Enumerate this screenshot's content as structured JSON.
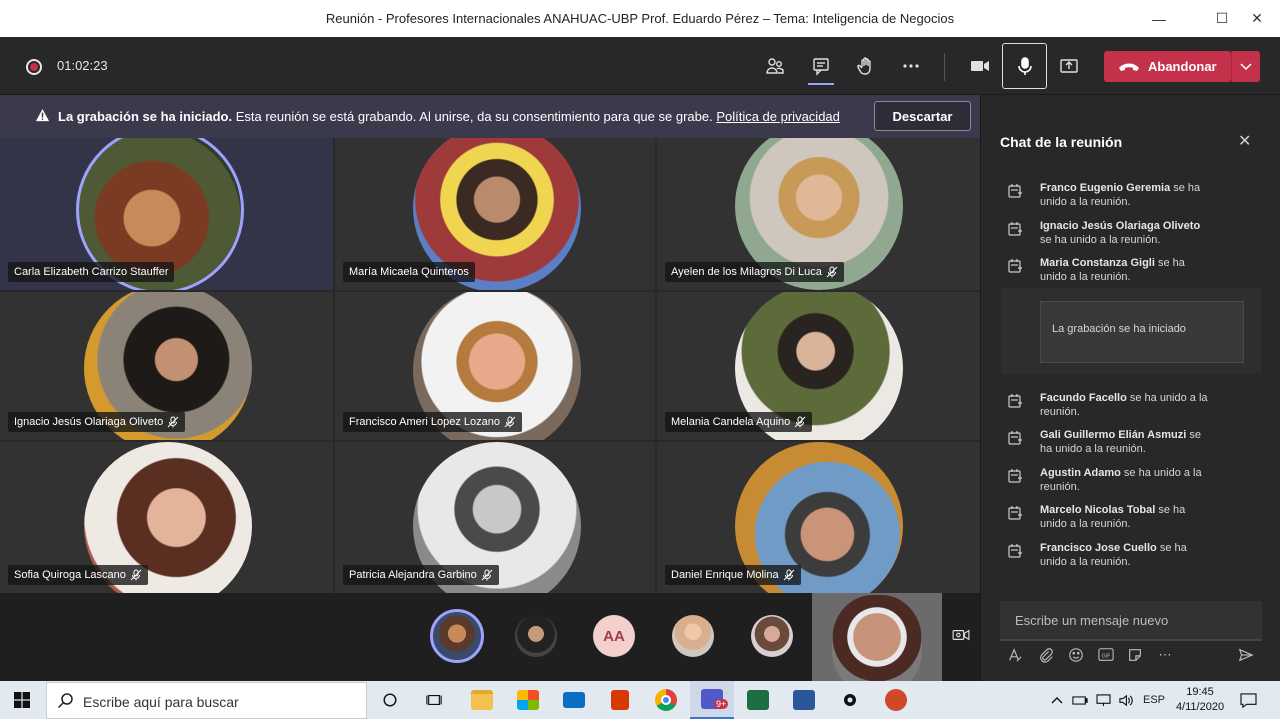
{
  "window": {
    "title": "Reunión - Profesores Internacionales ANAHUAC-UBP Prof. Eduardo Pérez – Tema: Inteligencia de Negocios"
  },
  "meeting": {
    "timer": "01:02:23",
    "leave_label": "Abandonar"
  },
  "banner": {
    "bold": "La grabación se ha iniciado.",
    "text": " Esta reunión se está grabando. Al unirse, da su consentimiento para que se grabe. ",
    "link": "Política de privacidad",
    "dismiss": "Descartar"
  },
  "participants": [
    {
      "name": "Carla Elizabeth Carrizo Stauffer",
      "muted": false,
      "active": true
    },
    {
      "name": "María Micaela Quinteros",
      "muted": false,
      "active": false
    },
    {
      "name": "Ayelen de los Milagros Di Luca",
      "muted": true,
      "active": false
    },
    {
      "name": "Ignacio Jesús Olariaga Oliveto",
      "muted": true,
      "active": false
    },
    {
      "name": "Francisco Ameri Lopez Lozano",
      "muted": true,
      "active": false
    },
    {
      "name": "Melania Candela Aquino",
      "muted": true,
      "active": false
    },
    {
      "name": "Sofia Quiroga Lascano",
      "muted": true,
      "active": false
    },
    {
      "name": "Patricia Alejandra Garbino",
      "muted": true,
      "active": false
    },
    {
      "name": "Daniel Enrique Molina",
      "muted": true,
      "active": false
    }
  ],
  "strip": {
    "initials": "AA"
  },
  "chat": {
    "title": "Chat de la reunión",
    "messages": [
      {
        "name": "Franco Eugenio Geremia",
        "text": " se ha unido a la reunión."
      },
      {
        "name": "Ignacio Jesús Olariaga Oliveto",
        "text": " se ha unido a la reunión."
      },
      {
        "name": "Maria Constanza Gigli",
        "text": " se ha unido a la reunión."
      },
      {
        "name": "Facundo Facello",
        "text": " se ha unido a la reunión."
      },
      {
        "name": "Gali Guillermo Elián Asmuzi",
        "text": " se ha unido a la reunión."
      },
      {
        "name": "Agustin Adamo",
        "text": " se ha unido a la reunión."
      },
      {
        "name": "Marcelo Nicolas Tobal",
        "text": " se ha unido a la reunión."
      },
      {
        "name": "Francisco Jose Cuello",
        "text": " se ha unido a la reunión."
      }
    ],
    "recording_notice": "La grabación se ha iniciado",
    "compose_placeholder": "Escribe un mensaje nuevo",
    "gif_label": "GIF"
  },
  "taskbar": {
    "search_placeholder": "Escribe aquí para buscar",
    "teams_badge": "9+",
    "lang": "ESP",
    "time": "19:45",
    "date": "4/11/2020"
  },
  "colors": {
    "accent": "#c4314b",
    "active_ring": "#9ea2ff",
    "banner": "#3b3a4d"
  }
}
